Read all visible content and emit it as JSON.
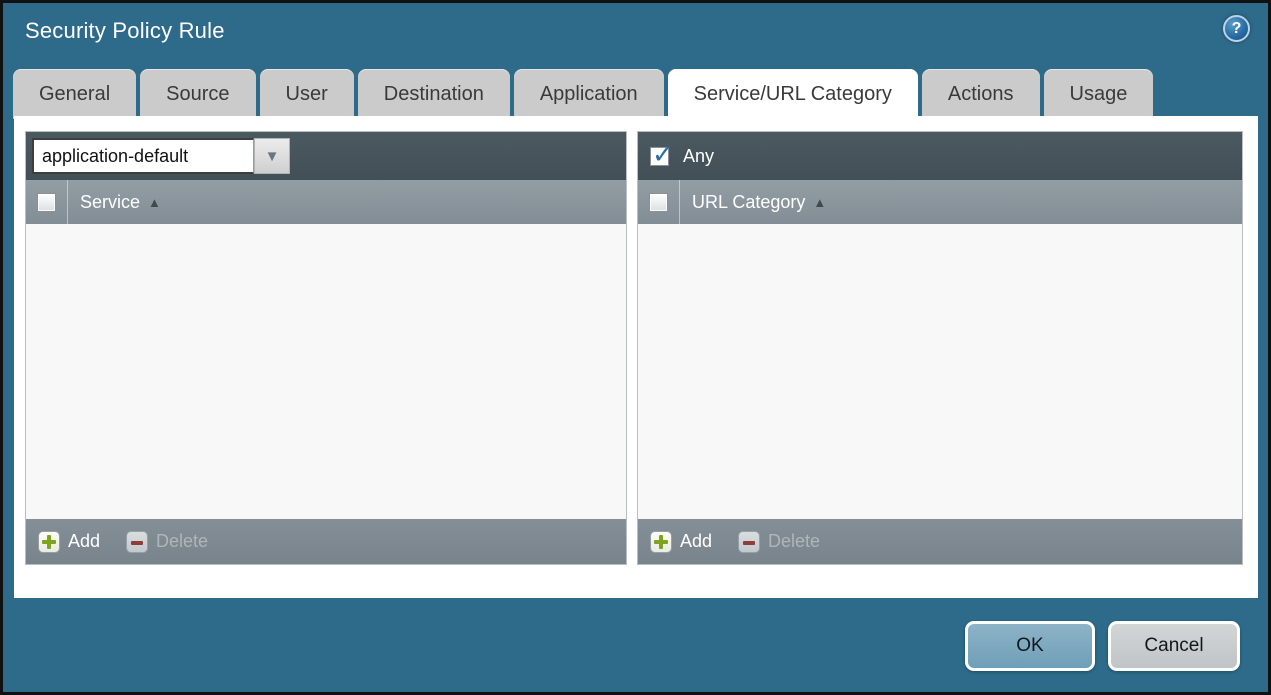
{
  "window": {
    "title": "Security Policy Rule"
  },
  "icons": {
    "help_glyph": "?",
    "dropdown_arrow": "▼",
    "sort_asc_arrow": "▲"
  },
  "tabs": {
    "active": "Service/URL Category",
    "items": [
      {
        "label": "General"
      },
      {
        "label": "Source"
      },
      {
        "label": "User"
      },
      {
        "label": "Destination"
      },
      {
        "label": "Application"
      },
      {
        "label": "Service/URL Category"
      },
      {
        "label": "Actions"
      },
      {
        "label": "Usage"
      }
    ]
  },
  "service_panel": {
    "dropdown_value": "application-default",
    "column_header": "Service",
    "sort": "ascending",
    "header_checkbox_checked": false,
    "rows": [],
    "add_label": "Add",
    "delete_label": "Delete",
    "delete_enabled": false
  },
  "url_category_panel": {
    "any_label": "Any",
    "any_checked": true,
    "column_header": "URL Category",
    "sort": "ascending",
    "header_checkbox_checked": false,
    "rows": [],
    "add_label": "Add",
    "delete_label": "Delete",
    "delete_enabled": false
  },
  "footer": {
    "ok_label": "OK",
    "cancel_label": "Cancel"
  },
  "colors": {
    "dialog_background": "#2e6b8b",
    "titlebar_text": "#ffffff",
    "tab_background": "#cbcbcb",
    "tab_active_background": "#ffffff",
    "panel_toolbar": "#46545c",
    "panel_header": "#87929a",
    "panel_footer": "#7d8890",
    "add_icon_green": "#7ea31f",
    "delete_icon_red": "#8e3d38",
    "check_blue": "#2d6da3",
    "ok_button": "#7aa8c0",
    "cancel_button": "#c8cccd"
  }
}
